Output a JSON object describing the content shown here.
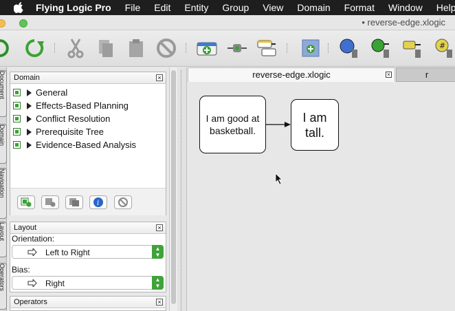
{
  "menubar": {
    "app_name": "Flying Logic Pro",
    "items": [
      "File",
      "Edit",
      "Entity",
      "Group",
      "View",
      "Domain",
      "Format",
      "Window",
      "Help"
    ]
  },
  "window": {
    "title": "• reverse-edge.xlogic"
  },
  "toolbar": {
    "icons": [
      "undo-icon",
      "redo-icon",
      "cut-icon",
      "copy-icon",
      "paste-icon",
      "delete-icon",
      "add-entity-icon",
      "insert-entity-icon",
      "add-annotation-icon",
      "add-group-icon",
      "confidence-icon",
      "edge-weight-icon",
      "entity-class-icon",
      "number-icon"
    ]
  },
  "side_tabs": [
    "Document",
    "Domain",
    "Navigation",
    "Layout",
    "Operators"
  ],
  "domain_panel": {
    "title": "Domain",
    "items": [
      {
        "label": "General"
      },
      {
        "label": "Effects-Based Planning"
      },
      {
        "label": "Conflict Resolution"
      },
      {
        "label": "Prerequisite Tree"
      },
      {
        "label": "Evidence-Based Analysis"
      }
    ]
  },
  "layout_panel": {
    "title": "Layout",
    "orientation_label": "Orientation:",
    "orientation_value": "Left to Right",
    "bias_label": "Bias:",
    "bias_value": "Right"
  },
  "operators_panel": {
    "title": "Operators"
  },
  "doc_tabs": {
    "active": "reverse-edge.xlogic",
    "inactive": "r"
  },
  "canvas": {
    "entities": [
      {
        "text": "I am good at basketball."
      },
      {
        "text": "I am tall."
      }
    ]
  },
  "colors": {
    "accent_green": "#3fa33a",
    "menubar_bg": "#1e1e1e"
  }
}
